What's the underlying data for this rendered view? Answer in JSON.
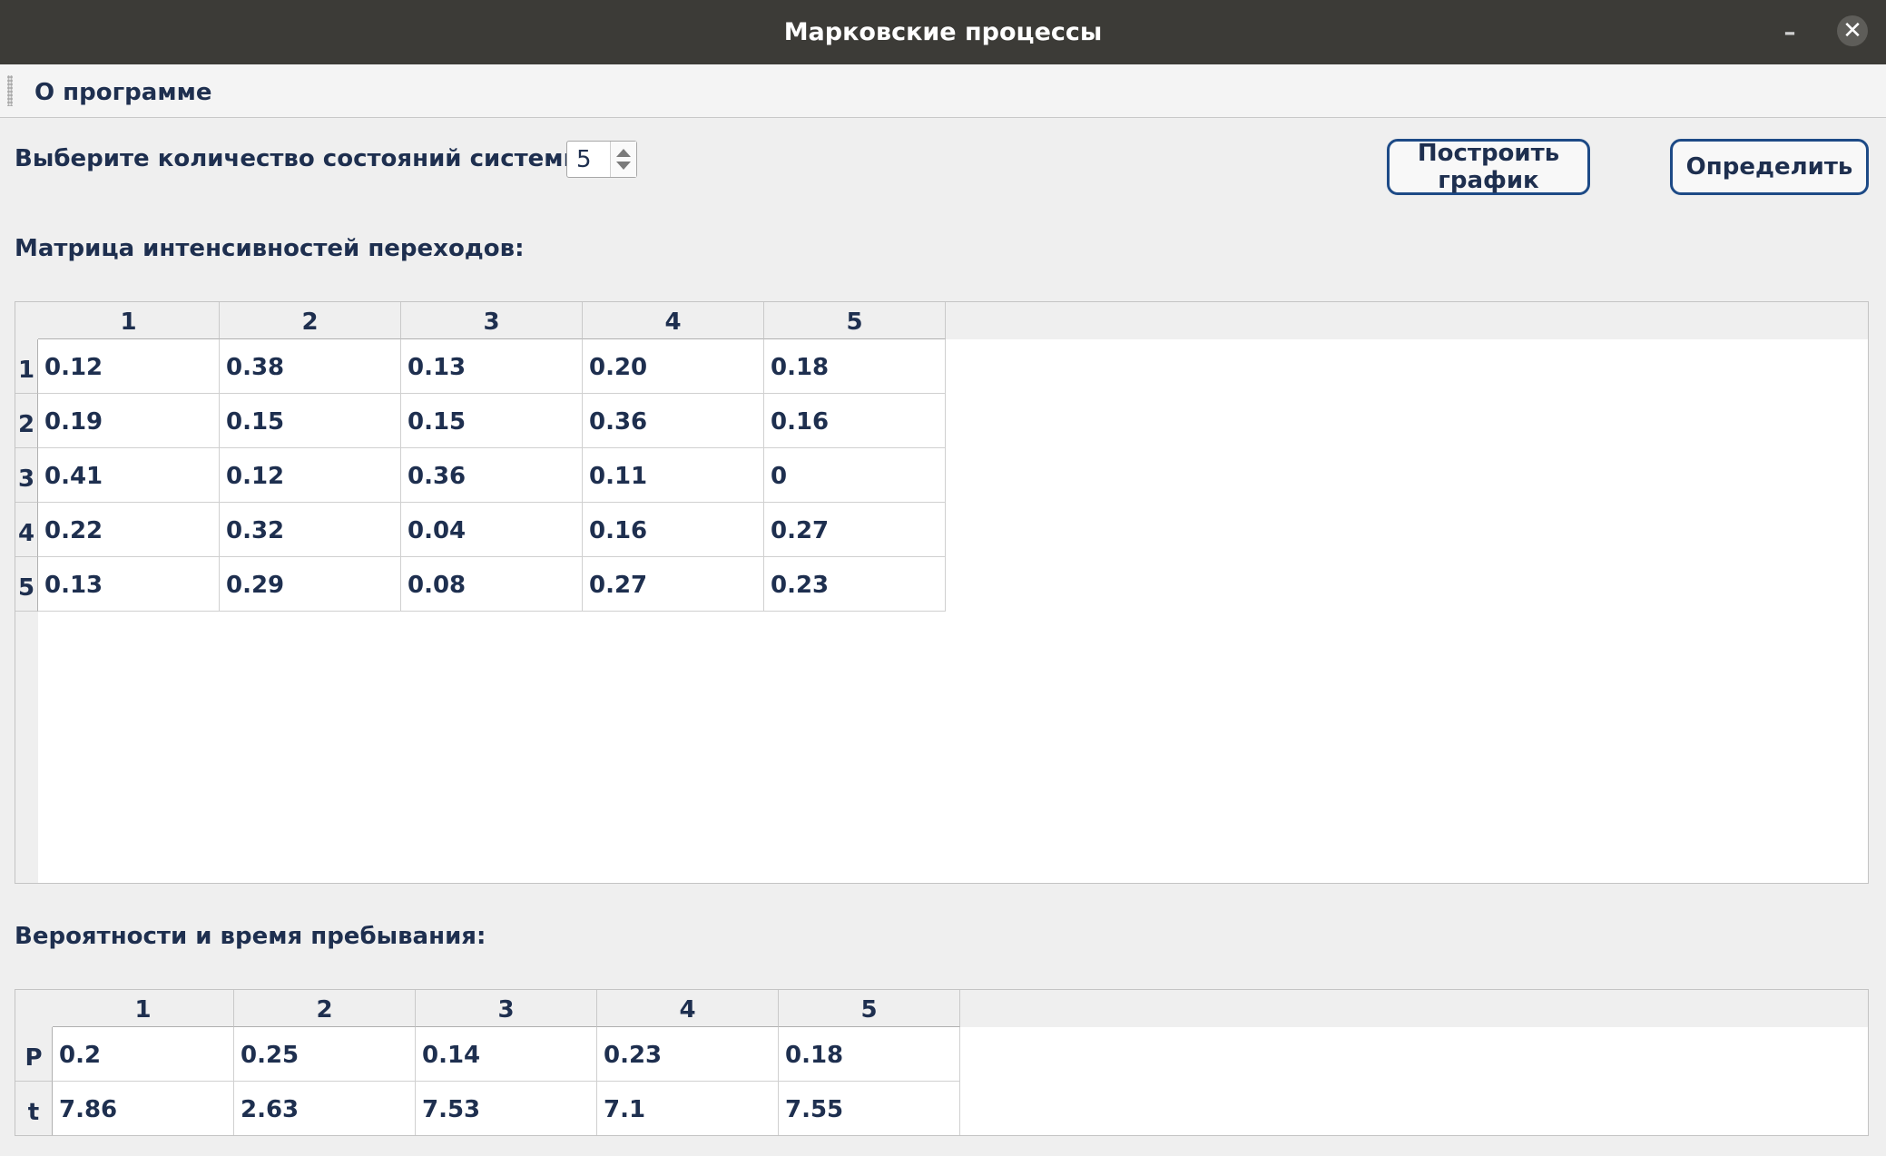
{
  "window": {
    "title": "Марковские процессы",
    "minimize_glyph": "–",
    "close_glyph": "✕"
  },
  "menu": {
    "items": [
      "О программе"
    ]
  },
  "controls": {
    "states_label": "Выберите количество состояний системы:",
    "states_value": "5",
    "plot_button": "Построить график",
    "determine_button": "Определить"
  },
  "matrix": {
    "title": "Матрица интенсивностей переходов:",
    "col_headers": [
      "1",
      "2",
      "3",
      "4",
      "5"
    ],
    "row_headers": [
      "1",
      "2",
      "3",
      "4",
      "5"
    ],
    "rows": [
      [
        "0.12",
        "0.38",
        "0.13",
        "0.20",
        "0.18"
      ],
      [
        "0.19",
        "0.15",
        "0.15",
        "0.36",
        "0.16"
      ],
      [
        "0.41",
        "0.12",
        "0.36",
        "0.11",
        "0"
      ],
      [
        "0.22",
        "0.32",
        "0.04",
        "0.16",
        "0.27"
      ],
      [
        "0.13",
        "0.29",
        "0.08",
        "0.27",
        "0.23"
      ]
    ]
  },
  "results": {
    "title": "Вероятности и время пребывания:",
    "col_headers": [
      "1",
      "2",
      "3",
      "4",
      "5"
    ],
    "row_headers": [
      "P",
      "t"
    ],
    "rows": [
      [
        "0.2",
        "0.25",
        "0.14",
        "0.23",
        "0.18"
      ],
      [
        "7.86",
        "2.63",
        "7.53",
        "7.1",
        "7.55"
      ]
    ]
  }
}
